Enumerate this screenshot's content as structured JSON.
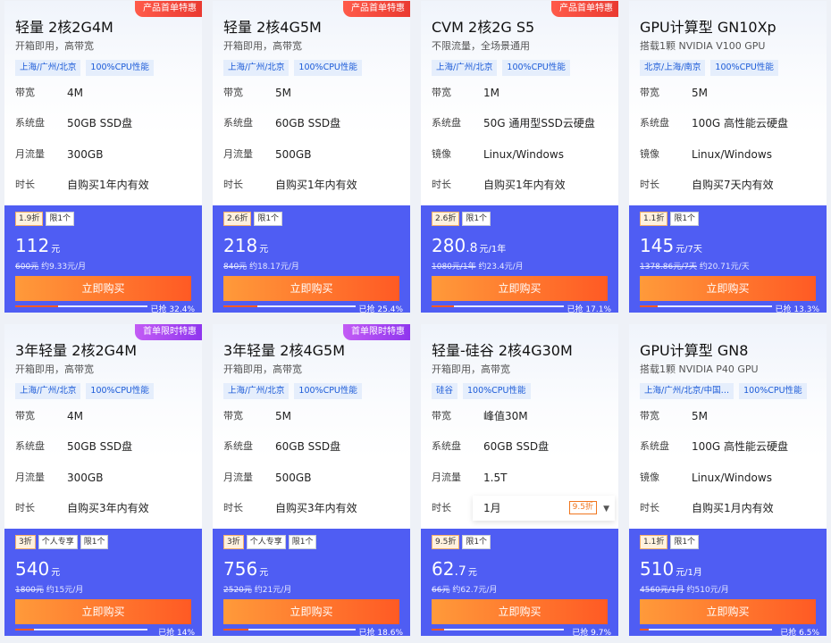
{
  "labels": {
    "bandwidth": "带宽",
    "disk": "系统盘",
    "traffic": "月流量",
    "image": "镜像",
    "duration": "时长",
    "buy": "立即购买"
  },
  "cards": [
    {
      "ribbon": "产品首单特惠",
      "ribbon_color": "red",
      "title": "轻量 2核2G4M",
      "subtitle": "开箱即用，高带宽",
      "tags": [
        "上海/广州/北京",
        "100%CPU性能"
      ],
      "specs": [
        {
          "k": "带宽",
          "v": "4M"
        },
        {
          "k": "系统盘",
          "v": "50GB SSD盘"
        },
        {
          "k": "月流量",
          "v": "300GB"
        },
        {
          "k": "时长",
          "v": "自购买1年内有效"
        }
      ],
      "badges": [
        "1.9折",
        "限1个"
      ],
      "price": "112",
      "price_unit": "元",
      "orig_price": "600元",
      "orig_suffix": "约9.33元/月",
      "sold_label": "已抢 32.4%",
      "sold_fraction": 0.324
    },
    {
      "ribbon": "产品首单特惠",
      "ribbon_color": "red",
      "title": "轻量 2核4G5M",
      "subtitle": "开箱即用，高带宽",
      "tags": [
        "上海/广州/北京",
        "100%CPU性能"
      ],
      "specs": [
        {
          "k": "带宽",
          "v": "5M"
        },
        {
          "k": "系统盘",
          "v": "60GB SSD盘"
        },
        {
          "k": "月流量",
          "v": "500GB"
        },
        {
          "k": "时长",
          "v": "自购买1年内有效"
        }
      ],
      "badges": [
        "2.6折",
        "限1个"
      ],
      "price": "218",
      "price_unit": "元",
      "orig_price": "840元",
      "orig_suffix": "约18.17元/月",
      "sold_label": "已抢 25.4%",
      "sold_fraction": 0.254
    },
    {
      "ribbon": "产品首单特惠",
      "ribbon_color": "red",
      "title": "CVM 2核2G S5",
      "subtitle": "不限流量，全场景通用",
      "tags": [
        "上海/广州/北京",
        "100%CPU性能"
      ],
      "specs": [
        {
          "k": "带宽",
          "v": "1M"
        },
        {
          "k": "系统盘",
          "v": "50G 通用型SSD云硬盘"
        },
        {
          "k": "镜像",
          "v": "Linux/Windows"
        },
        {
          "k": "时长",
          "v": "自购买1年内有效"
        }
      ],
      "badges": [
        "2.6折",
        "限1个"
      ],
      "price": "280",
      "price_decimal": ".8",
      "price_unit": "元/1年",
      "orig_price": "1080元/1年",
      "orig_suffix": "约23.4元/月",
      "sold_label": "已抢 17.1%",
      "sold_fraction": 0.171
    },
    {
      "ribbon": "",
      "ribbon_color": "",
      "title": "GPU计算型 GN10Xp",
      "subtitle": "搭载1颗 NVIDIA V100 GPU",
      "tags": [
        "北京/上海/南京",
        "100%CPU性能"
      ],
      "specs": [
        {
          "k": "带宽",
          "v": "5M"
        },
        {
          "k": "系统盘",
          "v": "100G 高性能云硬盘"
        },
        {
          "k": "镜像",
          "v": "Linux/Windows"
        },
        {
          "k": "时长",
          "v": "自购买7天内有效"
        }
      ],
      "badges": [
        "1.1折",
        "限1个"
      ],
      "price": "145",
      "price_unit": "元/7天",
      "orig_price": "1378.86元/7天",
      "orig_suffix": "约20.71元/天",
      "sold_label": "已抢 13.3%",
      "sold_fraction": 0.133
    },
    {
      "ribbon": "首单限时特惠",
      "ribbon_color": "purple",
      "title": "3年轻量 2核2G4M",
      "subtitle": "开箱即用，高带宽",
      "tags": [
        "上海/广州/北京",
        "100%CPU性能"
      ],
      "specs": [
        {
          "k": "带宽",
          "v": "4M"
        },
        {
          "k": "系统盘",
          "v": "50GB SSD盘"
        },
        {
          "k": "月流量",
          "v": "300GB"
        },
        {
          "k": "时长",
          "v": "自购买3年内有效"
        }
      ],
      "badges": [
        "3折",
        "个人专享",
        "限1个"
      ],
      "price": "540",
      "price_unit": "元",
      "orig_price": "1800元",
      "orig_suffix": "约15元/月",
      "sold_label": "已抢 14%",
      "sold_fraction": 0.14
    },
    {
      "ribbon": "首单限时特惠",
      "ribbon_color": "purple",
      "title": "3年轻量 2核4G5M",
      "subtitle": "开箱即用，高带宽",
      "tags": [
        "上海/广州/北京",
        "100%CPU性能"
      ],
      "specs": [
        {
          "k": "带宽",
          "v": "5M"
        },
        {
          "k": "系统盘",
          "v": "60GB SSD盘"
        },
        {
          "k": "月流量",
          "v": "500GB"
        },
        {
          "k": "时长",
          "v": "自购买3年内有效"
        }
      ],
      "badges": [
        "3折",
        "个人专享",
        "限1个"
      ],
      "price": "756",
      "price_unit": "元",
      "orig_price": "2520元",
      "orig_suffix": "约21元/月",
      "sold_label": "已抢 18.6%",
      "sold_fraction": 0.186
    },
    {
      "ribbon": "",
      "ribbon_color": "",
      "title": "轻量-硅谷 2核4G30M",
      "subtitle": "开箱即用，高带宽",
      "tags": [
        "硅谷",
        "100%CPU性能"
      ],
      "specs": [
        {
          "k": "带宽",
          "v": "峰值30M"
        },
        {
          "k": "系统盘",
          "v": "60GB SSD盘"
        },
        {
          "k": "月流量",
          "v": "1.5T"
        },
        {
          "k": "时长",
          "v": "1月",
          "select": true,
          "select_discount": "9.5折"
        }
      ],
      "badges": [
        "9.5折",
        "限1个"
      ],
      "price": "62",
      "price_decimal": ".7",
      "price_unit": "元",
      "orig_price": "66元",
      "orig_suffix": "约62.7元/月",
      "sold_label": "已抢 9.7%",
      "sold_fraction": 0.097
    },
    {
      "ribbon": "",
      "ribbon_color": "",
      "title": "GPU计算型 GN8",
      "subtitle": "搭载1颗 NVIDIA P40 GPU",
      "tags": [
        "上海/广州/北京/中国…",
        "100%CPU性能"
      ],
      "specs": [
        {
          "k": "带宽",
          "v": "5M"
        },
        {
          "k": "系统盘",
          "v": "100G 高性能云硬盘"
        },
        {
          "k": "镜像",
          "v": "Linux/Windows"
        },
        {
          "k": "时长",
          "v": "自购买1月内有效"
        }
      ],
      "badges": [
        "1.1折",
        "限1个"
      ],
      "price": "510",
      "price_unit": "元/1月",
      "orig_price": "4560元/1月",
      "orig_suffix": "约510元/月",
      "sold_label": "已抢 6.5%",
      "sold_fraction": 0.065
    }
  ]
}
